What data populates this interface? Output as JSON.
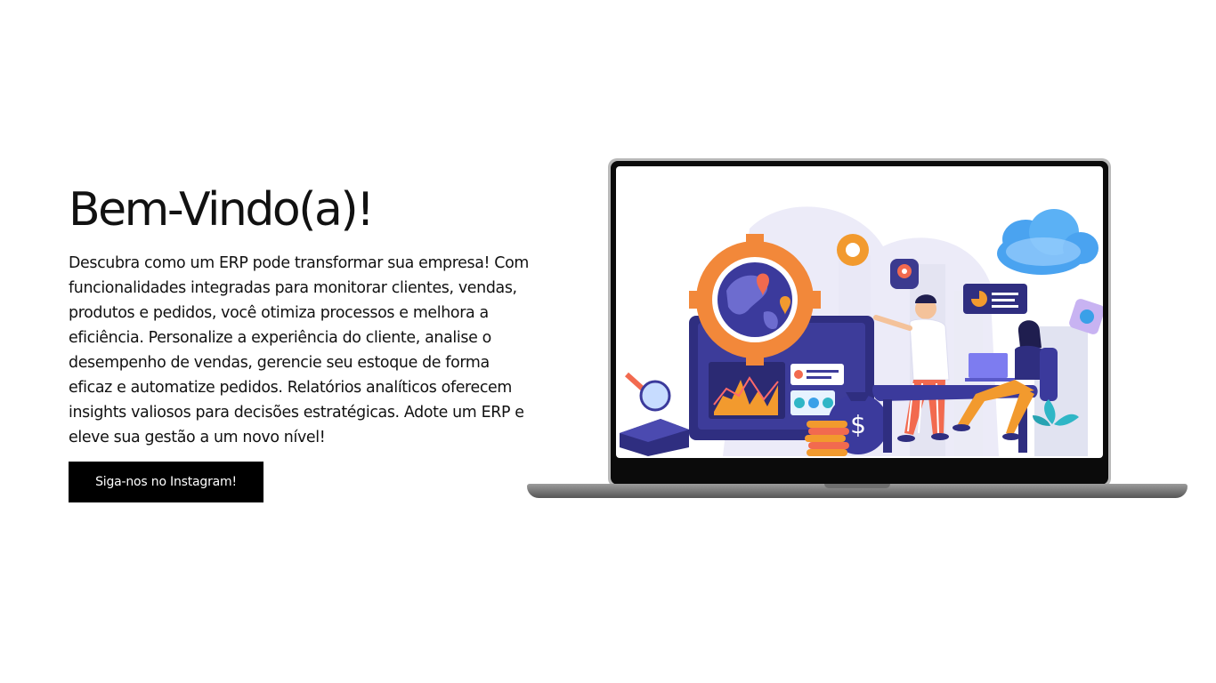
{
  "hero": {
    "title": "Bem-Vindo(a)!",
    "description": "Descubra como um ERP pode transformar sua empresa! Com funcionalidades integradas para monitorar clientes, vendas, produtos e pedidos, você otimiza processos e melhora a eficiência. Personalize a experiência do cliente, analise o desempenho de vendas, gerencie seu estoque de forma eficaz e automatize pedidos. Relatórios analíticos oferecem insights valiosos para decisões estratégicas. Adote um ERP e eleve sua gestão a um novo nível!",
    "button_label": "Siga-nos no Instagram!"
  },
  "illustration": {
    "icons": [
      "gear-icon",
      "map-pin-icon",
      "cloud-icon",
      "pie-chart-icon",
      "magnifier-icon",
      "dollar-bag-icon",
      "coins-icon",
      "settings-icon"
    ]
  }
}
